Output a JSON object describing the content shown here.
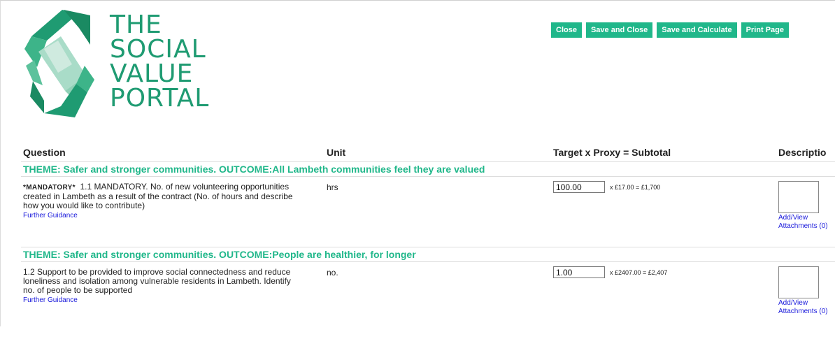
{
  "logo": {
    "words": [
      "THE",
      "SOCIAL",
      "VALUE",
      "PORTAL"
    ],
    "brand_color": "#1f9b72",
    "icon": "social-value-portal-logo"
  },
  "toolbar": {
    "close": "Close",
    "save_close": "Save and Close",
    "save_calculate": "Save and Calculate",
    "print": "Print Page",
    "button_color": "#20b78a"
  },
  "table": {
    "headers": {
      "question": "Question",
      "unit": "Unit",
      "target": "Target x Proxy = Subtotal",
      "description": "Descriptio"
    },
    "sections": [
      {
        "theme": "THEME: Safer and stronger communities. OUTCOME:All Lambeth communities feel they are valued",
        "mandatory": "*MANDATORY*",
        "question": "1.1 MANDATORY. No. of new volunteering opportunities created in Lambeth as a result of the contract (No. of hours and describe how you would like to contribute)",
        "guidance": "Further Guidance",
        "unit": "hrs",
        "target_value": "100.00",
        "calc": "x £17.00 = £1,700",
        "attachments": "Add/View Attachments (0)"
      },
      {
        "theme": "THEME: Safer and stronger communities. OUTCOME:People are healthier, for longer",
        "question": "1.2 Support to be provided to improve social connectedness and reduce loneliness and isolation among vulnerable residents in Lambeth. Identify no. of people to be supported",
        "guidance": "Further Guidance",
        "unit": "no.",
        "target_value": "1.00",
        "calc": "x £2407.00 = £2,407",
        "attachments": "Add/View Attachments (0)"
      }
    ]
  }
}
